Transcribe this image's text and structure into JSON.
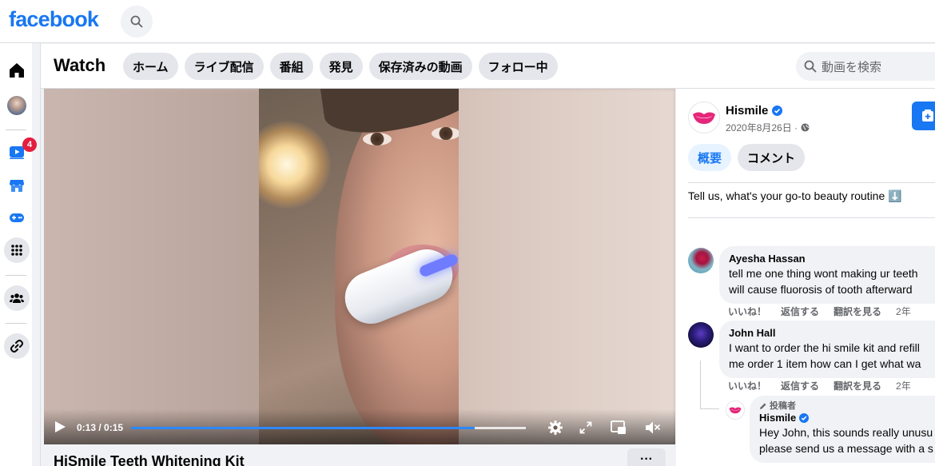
{
  "brand": {
    "logo_text": "facebook",
    "color": "#1877f2"
  },
  "nav": {
    "badge_count": "4"
  },
  "watch": {
    "title": "Watch",
    "tabs": [
      {
        "label": "ホーム"
      },
      {
        "label": "ライブ配信"
      },
      {
        "label": "番組"
      },
      {
        "label": "発見"
      },
      {
        "label": "保存済みの動画"
      },
      {
        "label": "フォロー中"
      }
    ],
    "search_placeholder": "動画を検索"
  },
  "video": {
    "time_display": "0:13 / 0:15",
    "progress": 0.87,
    "title": "HiSmile Teeth Whitening Kit",
    "more_label": "···"
  },
  "post": {
    "page_name": "Hismile",
    "date": "2020年8月26日 ·",
    "tab_summary": "概要",
    "tab_comments": "コメント",
    "caption": "Tell us, what's your go-to beauty routine ⬇️"
  },
  "comments": [
    {
      "name": "Ayesha Hassan",
      "line1": "tell me one thing wont making ur teeth",
      "line2": "will cause fluorosis of tooth afterward",
      "like": "いいね！",
      "reply": "返信する",
      "translate": "翻訳を見る",
      "age": "2年"
    },
    {
      "name": "John Hall",
      "line1": "I want to order the hi smile kit and refill",
      "line2": "me order 1 item how can I get what wa",
      "like": "いいね！",
      "reply": "返信する",
      "translate": "翻訳を見る",
      "age": "2年"
    }
  ],
  "reply": {
    "author_tag": "投稿者",
    "name": "Hismile",
    "line1": "Hey John, this sounds really unusu",
    "line2": "please send us a message with a s"
  }
}
